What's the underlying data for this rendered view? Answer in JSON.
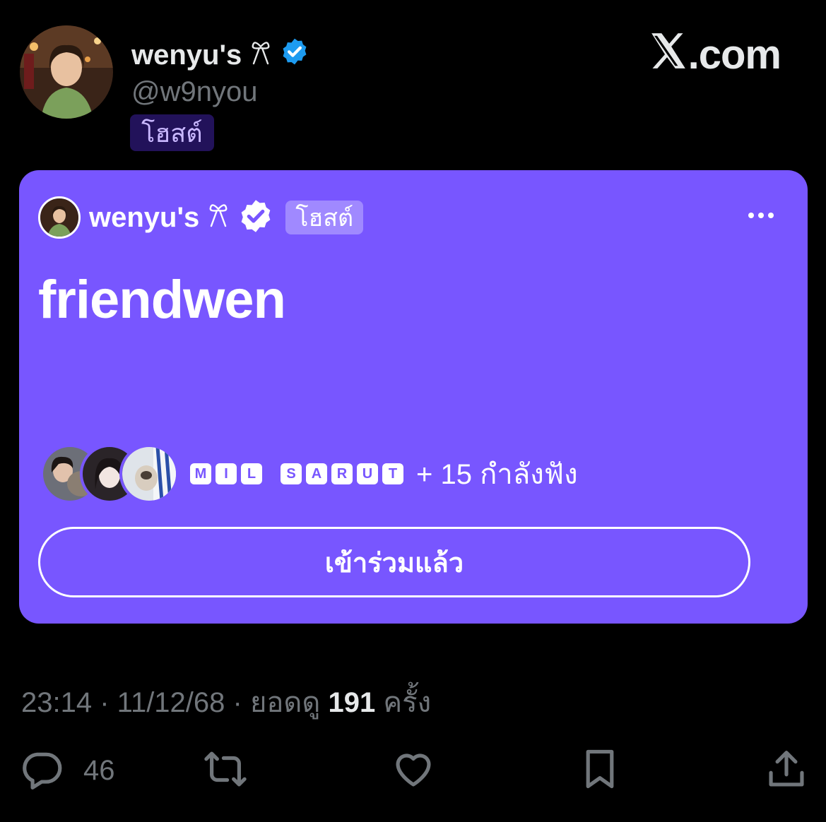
{
  "header": {
    "display_name": "wenyu's",
    "ribbon": "🎀",
    "handle": "@w9nyou",
    "host_badge": "โฮสต์",
    "brand": "X.com"
  },
  "space_card": {
    "host_name": "wenyu's",
    "ribbon": "🎀",
    "host_badge": "โฮสต์",
    "title": "friendwen",
    "listener_names": [
      [
        "M",
        "I",
        "L"
      ],
      [
        "S",
        "A",
        "R",
        "U",
        "T"
      ]
    ],
    "listening_text": "+ 15 กำลังฟัง",
    "joined_button": "เข้าร่วมแล้ว"
  },
  "meta": {
    "time": "23:14",
    "date": "11/12/68",
    "views_prefix": "ยอดดู",
    "views": "191",
    "views_suffix": "ครั้ง"
  },
  "actions": {
    "reply_count": "46"
  },
  "colors": {
    "background": "#000000",
    "card": "#7856ff",
    "verified": "#1d9bf0",
    "muted": "#71767b",
    "text": "#e7e9ea"
  }
}
